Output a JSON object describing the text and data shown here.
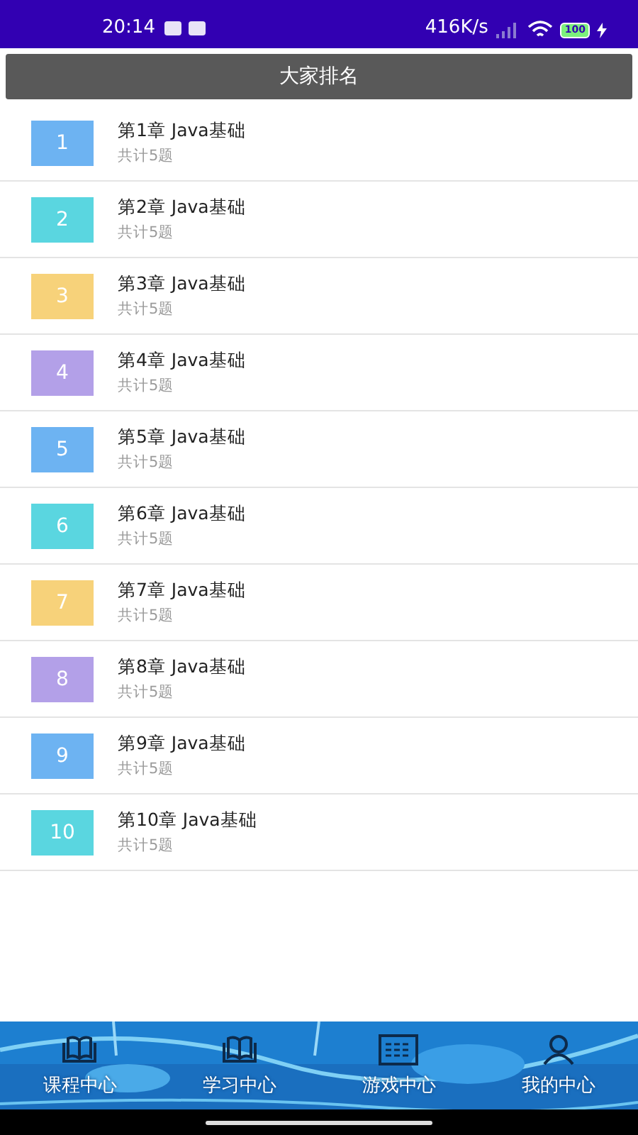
{
  "status_bar": {
    "time": "20:14",
    "speed": "416K/s",
    "battery": "100"
  },
  "header": {
    "title": "大家排名"
  },
  "chapters": [
    {
      "number": "1",
      "title": "第1章 Java基础",
      "subtitle": "共计5题",
      "color": "#6db3f2"
    },
    {
      "number": "2",
      "title": "第2章 Java基础",
      "subtitle": "共计5题",
      "color": "#5ad6e0"
    },
    {
      "number": "3",
      "title": "第3章 Java基础",
      "subtitle": "共计5题",
      "color": "#f7d27a"
    },
    {
      "number": "4",
      "title": "第4章 Java基础",
      "subtitle": "共计5题",
      "color": "#b3a0e8"
    },
    {
      "number": "5",
      "title": "第5章 Java基础",
      "subtitle": "共计5题",
      "color": "#6db3f2"
    },
    {
      "number": "6",
      "title": "第6章 Java基础",
      "subtitle": "共计5题",
      "color": "#5ad6e0"
    },
    {
      "number": "7",
      "title": "第7章 Java基础",
      "subtitle": "共计5题",
      "color": "#f7d27a"
    },
    {
      "number": "8",
      "title": "第8章 Java基础",
      "subtitle": "共计5题",
      "color": "#b3a0e8"
    },
    {
      "number": "9",
      "title": "第9章 Java基础",
      "subtitle": "共计5题",
      "color": "#6db3f2"
    },
    {
      "number": "10",
      "title": "第10章 Java基础",
      "subtitle": "共计5题",
      "color": "#5ad6e0"
    }
  ],
  "bottom_nav": [
    {
      "label": "课程中心",
      "kind": "book"
    },
    {
      "label": "学习中心",
      "kind": "book"
    },
    {
      "label": "游戏中心",
      "kind": "grid"
    },
    {
      "label": "我的中心",
      "kind": "person"
    }
  ]
}
